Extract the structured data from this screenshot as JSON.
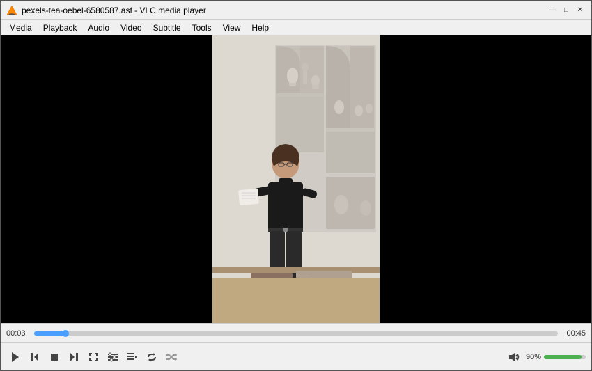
{
  "titleBar": {
    "title": "pexels-tea-oebel-6580587.asf - VLC media player",
    "minLabel": "—",
    "maxLabel": "□",
    "closeLabel": "✕"
  },
  "menuBar": {
    "items": [
      {
        "id": "media",
        "label": "Media"
      },
      {
        "id": "playback",
        "label": "Playback"
      },
      {
        "id": "audio",
        "label": "Audio"
      },
      {
        "id": "video",
        "label": "Video"
      },
      {
        "id": "subtitle",
        "label": "Subtitle"
      },
      {
        "id": "tools",
        "label": "Tools"
      },
      {
        "id": "view",
        "label": "View"
      },
      {
        "id": "help",
        "label": "Help"
      }
    ]
  },
  "controls": {
    "currentTime": "00:03",
    "totalTime": "00:45",
    "progressPercent": 6,
    "volumePercent": 90,
    "volumeLabel": "90%"
  },
  "colors": {
    "progressFill": "#4a9eff",
    "volumeFill": "#4caf50",
    "menuBg": "#f0f0f0"
  }
}
